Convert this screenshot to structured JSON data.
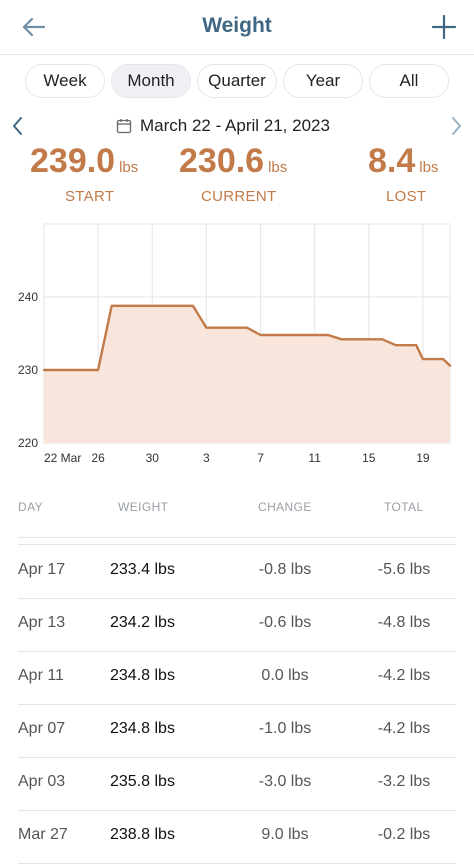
{
  "header": {
    "title": "Weight"
  },
  "periods": [
    {
      "label": "Week",
      "active": false
    },
    {
      "label": "Month",
      "active": true
    },
    {
      "label": "Quarter",
      "active": false
    },
    {
      "label": "Year",
      "active": false
    },
    {
      "label": "All",
      "active": false
    }
  ],
  "date_range": "March 22 - April 21, 2023",
  "stats": {
    "start": {
      "value": "239.0",
      "unit": "lbs",
      "label": "START"
    },
    "current": {
      "value": "230.6",
      "unit": "lbs",
      "label": "CURRENT"
    },
    "lost": {
      "value": "8.4",
      "unit": "lbs",
      "label": "LOST"
    }
  },
  "colors": {
    "accent": "#c17a48",
    "title": "#3f6783",
    "fill": "#f8e6dd"
  },
  "chart_data": {
    "type": "area",
    "xlabel": "",
    "ylabel": "",
    "ylim": [
      220,
      250
    ],
    "yticks": [
      220,
      230,
      240
    ],
    "x_tick_labels": [
      "22 Mar",
      "26",
      "30",
      "3",
      "7",
      "11",
      "15",
      "19"
    ],
    "x_tick_days": [
      0,
      4,
      8,
      12,
      16,
      20,
      24,
      28
    ],
    "xlim_days": [
      0,
      30
    ],
    "grid": true,
    "series": [
      {
        "points": [
          {
            "day": 0,
            "value": 230.0
          },
          {
            "day": 4,
            "value": 230.0
          },
          {
            "day": 5,
            "value": 238.8
          },
          {
            "day": 11,
            "value": 238.8
          },
          {
            "day": 12,
            "value": 235.8
          },
          {
            "day": 15,
            "value": 235.8
          },
          {
            "day": 16,
            "value": 234.8
          },
          {
            "day": 21,
            "value": 234.8
          },
          {
            "day": 22,
            "value": 234.2
          },
          {
            "day": 25,
            "value": 234.2
          },
          {
            "day": 26,
            "value": 233.4
          },
          {
            "day": 27.5,
            "value": 233.4
          },
          {
            "day": 28,
            "value": 231.5
          },
          {
            "day": 29.5,
            "value": 231.5
          },
          {
            "day": 30,
            "value": 230.6
          }
        ]
      }
    ]
  },
  "table": {
    "headers": {
      "day": "DAY",
      "weight": "WEIGHT",
      "change": "CHANGE",
      "total": "TOTAL"
    },
    "rows": [
      {
        "day": "Apr 17",
        "weight": "233.4 lbs",
        "change": "-0.8 lbs",
        "total": "-5.6 lbs"
      },
      {
        "day": "Apr 13",
        "weight": "234.2 lbs",
        "change": "-0.6 lbs",
        "total": "-4.8 lbs"
      },
      {
        "day": "Apr 11",
        "weight": "234.8 lbs",
        "change": "0.0 lbs",
        "total": "-4.2 lbs"
      },
      {
        "day": "Apr 07",
        "weight": "234.8 lbs",
        "change": "-1.0 lbs",
        "total": "-4.2 lbs"
      },
      {
        "day": "Apr 03",
        "weight": "235.8 lbs",
        "change": "-3.0 lbs",
        "total": "-3.2 lbs"
      },
      {
        "day": "Mar 27",
        "weight": "238.8 lbs",
        "change": "9.0 lbs",
        "total": "-0.2 lbs"
      }
    ]
  }
}
